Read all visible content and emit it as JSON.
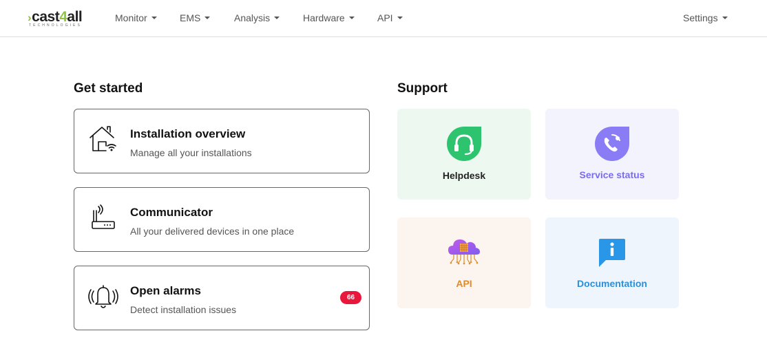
{
  "brand": {
    "name_prefix": "cast",
    "name_digit": "4",
    "name_suffix": "all",
    "tagline": "TECHNOLOGIES"
  },
  "nav": {
    "items": [
      {
        "label": "Monitor"
      },
      {
        "label": "EMS"
      },
      {
        "label": "Analysis"
      },
      {
        "label": "Hardware"
      },
      {
        "label": "API"
      }
    ],
    "settings_label": "Settings"
  },
  "get_started": {
    "title": "Get started",
    "cards": [
      {
        "title": "Installation overview",
        "description": "Manage all your installations",
        "icon": "house-wifi-icon"
      },
      {
        "title": "Communicator",
        "description": "All your delivered devices in one place",
        "icon": "router-icon"
      },
      {
        "title": "Open alarms",
        "description": "Detect installation issues",
        "icon": "bell-ringing-icon",
        "badge": "66"
      }
    ]
  },
  "support": {
    "title": "Support",
    "tiles": [
      {
        "label": "Helpdesk",
        "icon": "headset-icon",
        "bg": "#edf8f1",
        "color": "#222222",
        "icon_color": "#2ec46f"
      },
      {
        "label": "Service status",
        "icon": "phone-signal-icon",
        "bg": "#f3f3fd",
        "color": "#7a6cf0",
        "icon_color": "#8a7cf5"
      },
      {
        "label": "API",
        "icon": "cloud-chip-icon",
        "bg": "#fcf4ee",
        "color": "#e08a2c",
        "icon_color": "#9b5cf0"
      },
      {
        "label": "Documentation",
        "icon": "info-chat-icon",
        "bg": "#eef5fd",
        "color": "#2a8fd9",
        "icon_color": "#2a96e8"
      }
    ]
  },
  "colors": {
    "accent_green": "#8cc63f",
    "badge_red": "#e8173c"
  }
}
